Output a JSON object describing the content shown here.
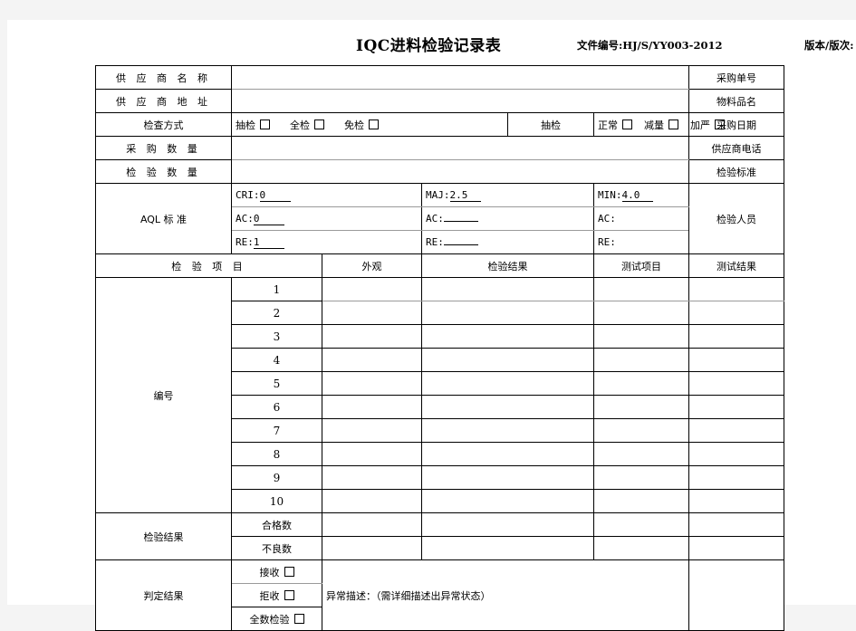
{
  "header": {
    "title": "IQC进料检验记录表",
    "doc_code": "文件编号:HJ/S/YY003-2012",
    "version": "版本/版次:"
  },
  "rows": {
    "supplier_name": "供 应 商 名 称",
    "supplier_address": "供 应 商 地 址",
    "inspect_method": "检查方式",
    "purchase_qty": "采 购 数 量",
    "inspect_qty": "检 验 数 量",
    "aql_standard": "AQL 标    准",
    "po_number": "采购单号",
    "material_name": "物料品名",
    "purchase_date": "采购日期",
    "supplier_phone": "供应商电话",
    "inspect_standard": "检验标准",
    "inspector": "检验人员"
  },
  "method_options": [
    {
      "label": "抽检"
    },
    {
      "label": "全检"
    },
    {
      "label": "免检"
    }
  ],
  "sampling_label": "抽检",
  "sampling_options": [
    {
      "label": "正常"
    },
    {
      "label": "减量"
    },
    {
      "label": "加严"
    }
  ],
  "aql": {
    "cri_label": "CRI:",
    "cri_value": "0",
    "maj_label": "MAJ:",
    "maj_value": "2.5",
    "min_label": "MIN:",
    "min_value": "4.0",
    "ac_label": "AC:",
    "ac_cri": "0",
    "ac_maj": "",
    "ac_min": "",
    "re_label": "RE:",
    "re_cri": "1",
    "re_maj": "",
    "re_min": ""
  },
  "table_headers": {
    "inspect_item": "检 验 项 目",
    "appearance": "外观",
    "inspect_result": "检验结果",
    "test_item": "测试项目",
    "test_result": "测试结果"
  },
  "serial": {
    "label": "编号",
    "numbers": [
      "1",
      "2",
      "3",
      "4",
      "5",
      "6",
      "7",
      "8",
      "9",
      "10"
    ]
  },
  "result": {
    "label": "检验结果",
    "pass_count": "合格数",
    "fail_count": "不良数"
  },
  "judgement": {
    "label": "判定结果",
    "options": [
      {
        "label": "接收"
      },
      {
        "label": "拒收"
      },
      {
        "label": "全数检验"
      }
    ],
    "abnormal_desc": "异常描述：（需详细描述出异常状态）"
  }
}
